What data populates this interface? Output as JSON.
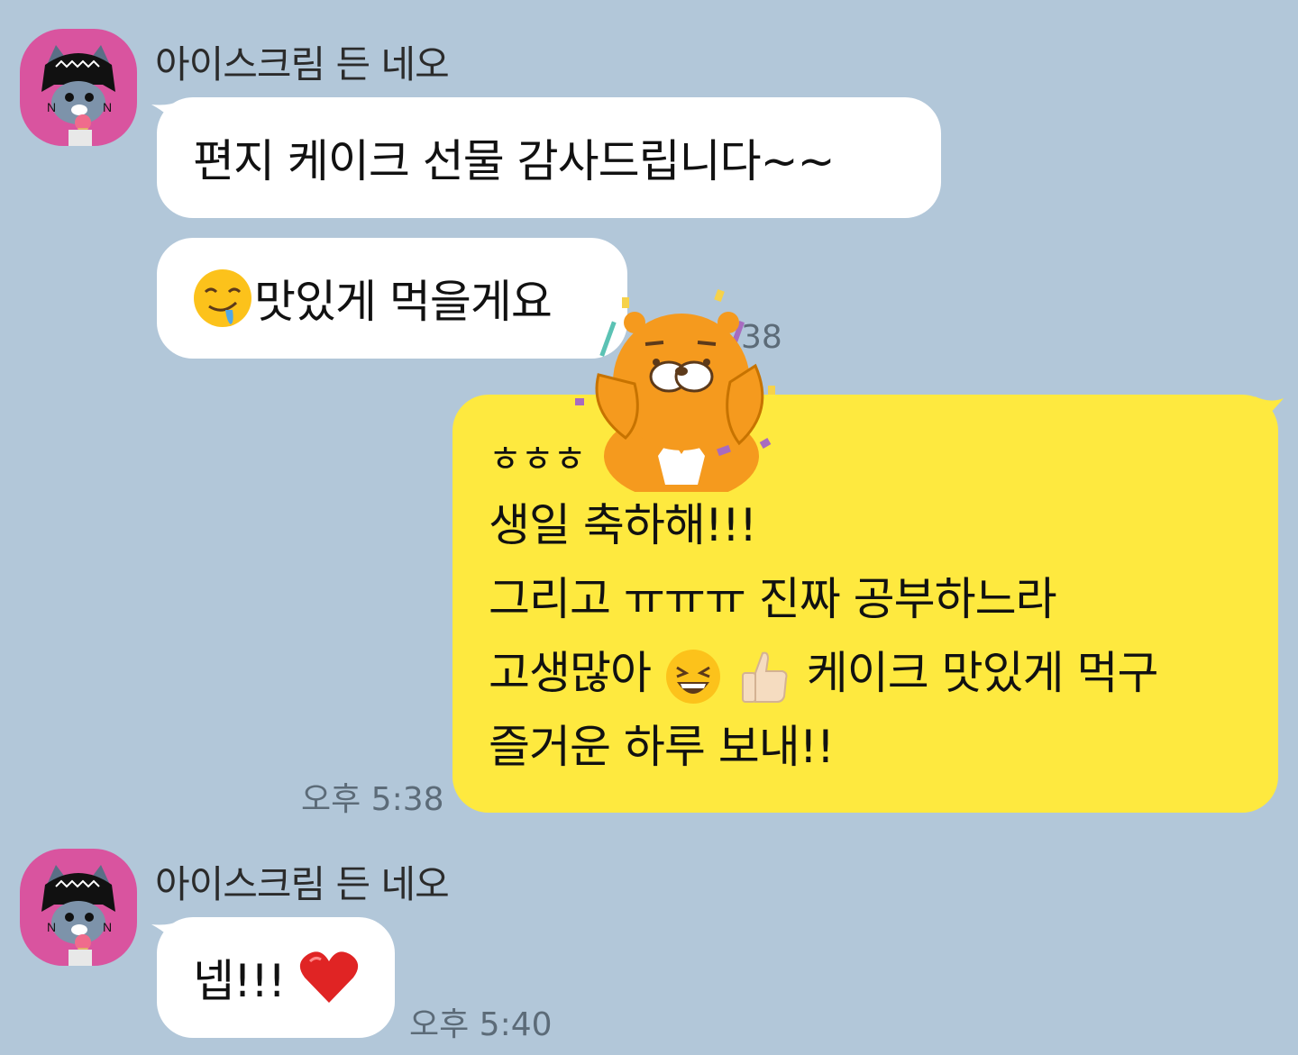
{
  "colors": {
    "background": "#b2c7d9",
    "incoming_bubble": "#ffffff",
    "outgoing_bubble": "#fee93f",
    "avatar_bg": "#d9549f",
    "timestamp": "#5c6b78"
  },
  "messages": [
    {
      "direction": "incoming",
      "sender": "아이스크림 든 네오",
      "avatar": "neo-character-avatar",
      "bubbles": [
        "편지 케이크 선물 감사드립니다~~",
        "맛있게 먹을게요"
      ],
      "bubble_icons": [
        "drooling-face-emoji"
      ],
      "time_partial": "38"
    },
    {
      "direction": "outgoing",
      "sticker": "ryan-celebration-sticker",
      "lines": [
        "ㅎㅎㅎ",
        "생일 축하해!!!",
        "그리고 ㅠㅠㅠ 진짜 공부하느라",
        "고생많아",
        "케이크 맛있게 먹구",
        "즐거운 하루 보내!!"
      ],
      "line_icons": [
        "grinning-squinting-face-emoji",
        "thumbs-up-light-skin-emoji"
      ],
      "time": "오후 5:38"
    },
    {
      "direction": "incoming",
      "sender": "아이스크림 든 네오",
      "avatar": "neo-character-avatar",
      "bubbles": [
        "넵!!!"
      ],
      "bubble_icons": [
        "red-heart-emoji"
      ],
      "time": "오후 5:40"
    }
  ]
}
